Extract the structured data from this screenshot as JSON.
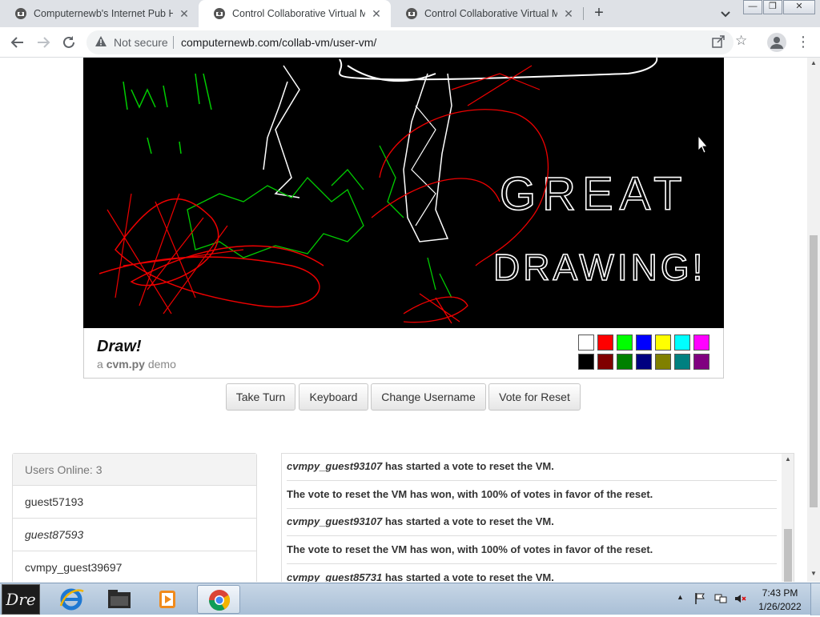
{
  "browser": {
    "tabs": [
      {
        "title": "Computernewb's Internet Pub Hu",
        "active": false
      },
      {
        "title": "Control Collaborative Virtual Ma",
        "active": true
      },
      {
        "title": "Control Collaborative Virtual Ma",
        "active": false
      }
    ],
    "new_tab_label": "+",
    "security_label": "Not secure",
    "url": "computernewb.com/collab-vm/user-vm/"
  },
  "vm": {
    "drawing_text": [
      "GREAT",
      "DRAWING!"
    ]
  },
  "demo": {
    "title": "Draw!",
    "subtitle_prefix": "a",
    "subtitle_app": "cvm.py",
    "subtitle_suffix": "demo",
    "palette_top": [
      "#ffffff",
      "#ff0000",
      "#00ff00",
      "#0000ff",
      "#ffff00",
      "#00ffff",
      "#ff00ff"
    ],
    "palette_bottom": [
      "#000000",
      "#800000",
      "#008000",
      "#000080",
      "#808000",
      "#008080",
      "#800080"
    ]
  },
  "buttons": {
    "take_turn": "Take Turn",
    "keyboard": "Keyboard",
    "change_username": "Change Username",
    "vote_reset": "Vote for Reset"
  },
  "users": {
    "header": "Users Online: 3",
    "list": [
      {
        "name": "guest57193",
        "italic": false
      },
      {
        "name": "guest87593",
        "italic": true
      },
      {
        "name": "cvmpy_guest39697",
        "italic": false
      }
    ]
  },
  "chat": {
    "messages": [
      {
        "who": "cvmpy_guest93107",
        "text": " has started a vote to reset the VM."
      },
      {
        "who": "",
        "text": "The vote to reset the VM has won, with 100% of votes in favor of the reset."
      },
      {
        "who": "cvmpy_guest93107",
        "text": " has started a vote to reset the VM."
      },
      {
        "who": "",
        "text": "The vote to reset the VM has won, with 100% of votes in favor of the reset."
      },
      {
        "who": "cvmpy_guest85731",
        "text": " has started a vote to reset the VM."
      }
    ]
  },
  "taskbar": {
    "start_label": "Dre",
    "clock_time": "7:43 PM",
    "clock_date": "1/26/2022"
  }
}
